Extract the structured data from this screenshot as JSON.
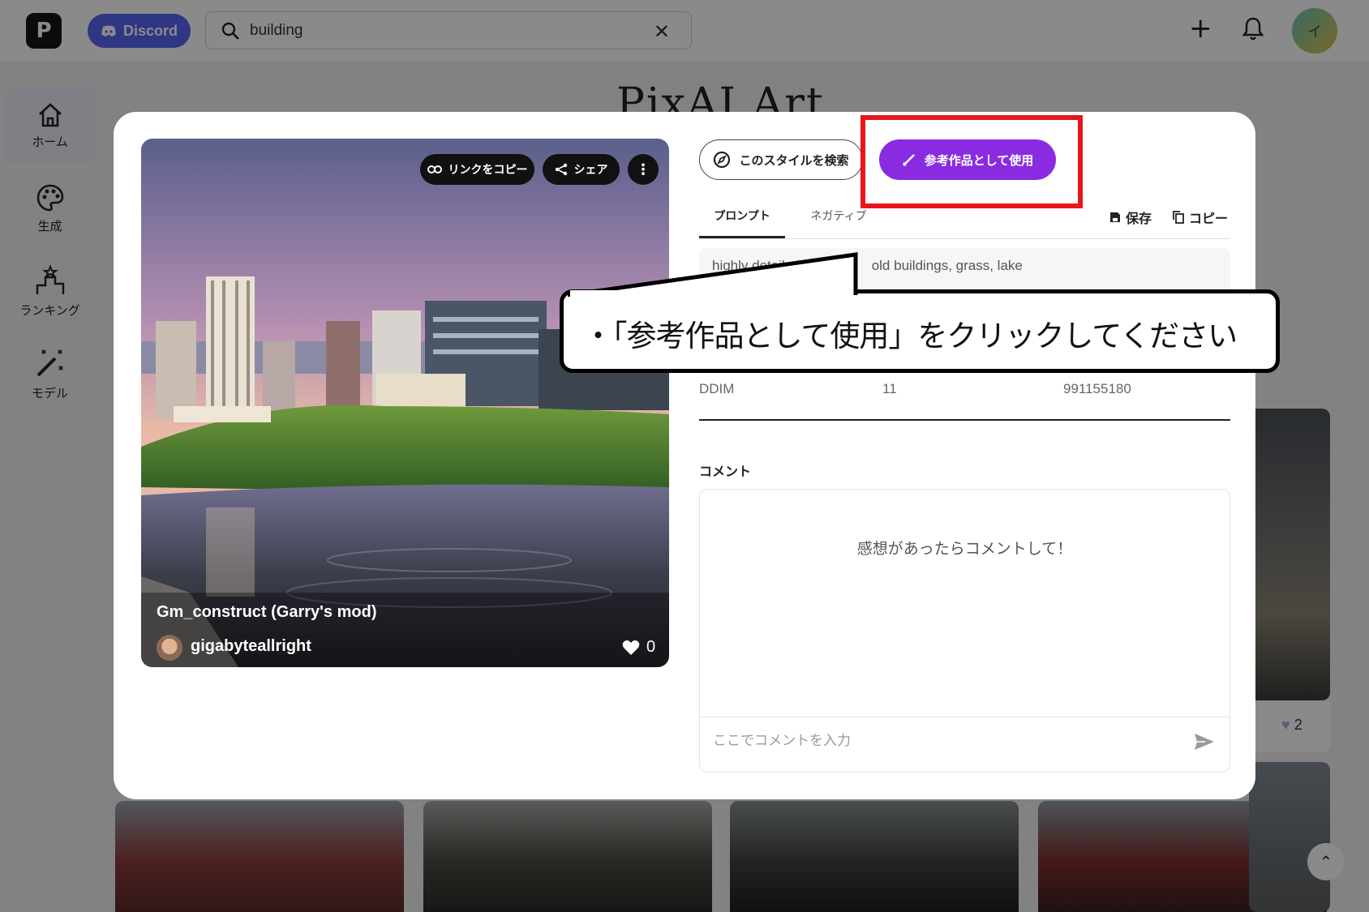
{
  "topbar": {
    "logo_letter": "P",
    "discord_label": "Discord",
    "search_value": "building",
    "avatar_letter": "イ"
  },
  "sidebar": {
    "items": [
      {
        "label": "ホーム",
        "icon": "home-icon"
      },
      {
        "label": "生成",
        "icon": "palette-icon"
      },
      {
        "label": "ランキング",
        "icon": "ranking-icon"
      },
      {
        "label": "モデル",
        "icon": "magic-wand-icon"
      }
    ]
  },
  "background": {
    "page_title": "PixAI Art",
    "right_card_likes": "2"
  },
  "artwork": {
    "title": "Gm_construct (Garry's mod)",
    "author": "gigabyteallright",
    "likes": "0",
    "copy_link_label": "リンクをコピー",
    "share_label": "シェア"
  },
  "actions": {
    "search_style_label": "このスタイルを検索",
    "use_reference_label": "参考作品として使用"
  },
  "tabs": {
    "prompt_label": "プロンプト",
    "negative_label": "ネガティブ",
    "save_label": "保存",
    "copy_label": "コピー"
  },
  "prompt": {
    "visible_start": "highly detailed",
    "visible_end": "old buildings, grass, lake"
  },
  "params": {
    "sampler": "DDIM",
    "steps": "11",
    "seed": "991155180"
  },
  "comments": {
    "label": "コメント",
    "empty_message": "感想があったらコメントして！",
    "input_placeholder": "ここでコメントを入力"
  },
  "callout": {
    "text": "・「参考作品として使用」をクリックしてください"
  },
  "colors": {
    "accent_purple": "#8a2be2",
    "highlight_red": "#e8161b",
    "discord_blue": "#5865f2"
  }
}
